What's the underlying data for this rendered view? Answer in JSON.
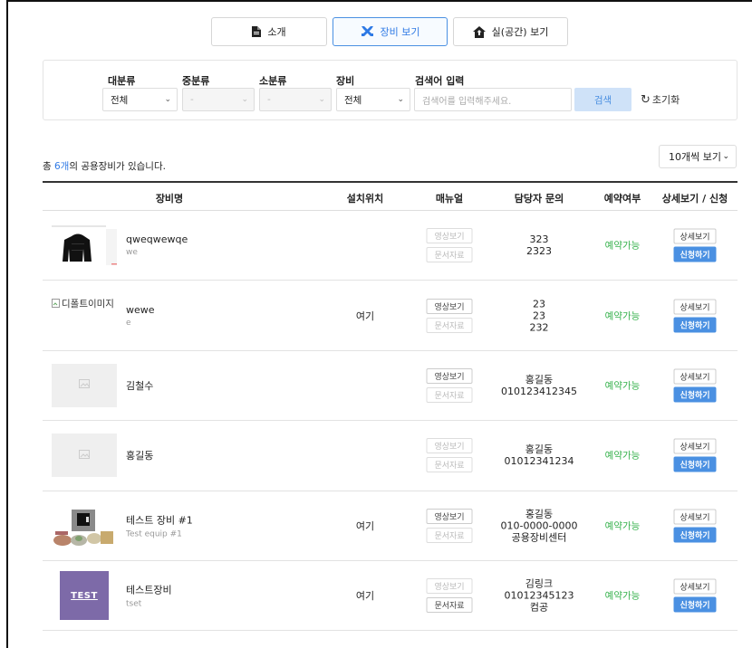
{
  "tabs": [
    {
      "label": "소개",
      "icon": "document-icon",
      "active": false
    },
    {
      "label": "장비 보기",
      "icon": "tools-icon",
      "active": true
    },
    {
      "label": "실(공간) 보기",
      "icon": "home-icon",
      "active": false
    }
  ],
  "filter": {
    "category_large": {
      "label": "대분류",
      "value": "전체"
    },
    "category_medium": {
      "label": "중분류",
      "value": "-"
    },
    "category_small": {
      "label": "소분류",
      "value": "-"
    },
    "equipment": {
      "label": "장비",
      "value": "전체"
    },
    "keyword": {
      "label": "검색어 입력",
      "placeholder": "검색어를 입력해주세요."
    },
    "search_label": "검색",
    "reset_label": "초기화"
  },
  "summary": {
    "prefix": "총 ",
    "count": "6개",
    "suffix": "의 공용장비가 있습니다."
  },
  "per_page": "10개씩 보기",
  "table": {
    "headers": [
      "장비명",
      "설치위치",
      "매뉴얼",
      "담당자 문의",
      "예약여부",
      "상세보기 / 신청"
    ],
    "video_label": "영상보기",
    "doc_label": "문서자료",
    "detail_label": "상세보기",
    "apply_label": "신청하기",
    "rows": [
      {
        "name": "qweqwewqe",
        "sub": "we",
        "location": "",
        "contact": [
          "323",
          "2323"
        ],
        "status": "예약가능",
        "video_enabled": false,
        "doc_enabled": false,
        "thumb": "jacket"
      },
      {
        "name": "wewe",
        "sub": "e",
        "location": "여기",
        "contact": [
          "23",
          "23",
          "232"
        ],
        "status": "예약가능",
        "video_enabled": true,
        "doc_enabled": false,
        "thumb": "broken",
        "thumb_alt": "디폴트이미지"
      },
      {
        "name": "김철수",
        "sub": "",
        "location": "",
        "contact": [
          "홍길동",
          "010123412345"
        ],
        "status": "예약가능",
        "video_enabled": true,
        "doc_enabled": false,
        "thumb": "placeholder"
      },
      {
        "name": "홍길동",
        "sub": "",
        "location": "",
        "contact": [
          "홍길동",
          "01012341234"
        ],
        "status": "예약가능",
        "video_enabled": false,
        "doc_enabled": false,
        "thumb": "placeholder"
      },
      {
        "name": "테스트 장비 #1",
        "sub": "Test equip #1",
        "location": "여기",
        "contact": [
          "홍길동",
          "010-0000-0000",
          "공용장비센터"
        ],
        "status": "예약가능",
        "video_enabled": true,
        "doc_enabled": false,
        "thumb": "equipment"
      },
      {
        "name": "테스트장비",
        "sub": "tset",
        "location": "여기",
        "contact": [
          "김링크",
          "01012345123",
          "컴공"
        ],
        "status": "예약가능",
        "video_enabled": false,
        "doc_enabled": true,
        "thumb": "test",
        "thumb_text": "TEST"
      }
    ]
  },
  "colors": {
    "accent": "#4a90e2",
    "available": "#37b24d",
    "count": "#2f7ae5"
  }
}
